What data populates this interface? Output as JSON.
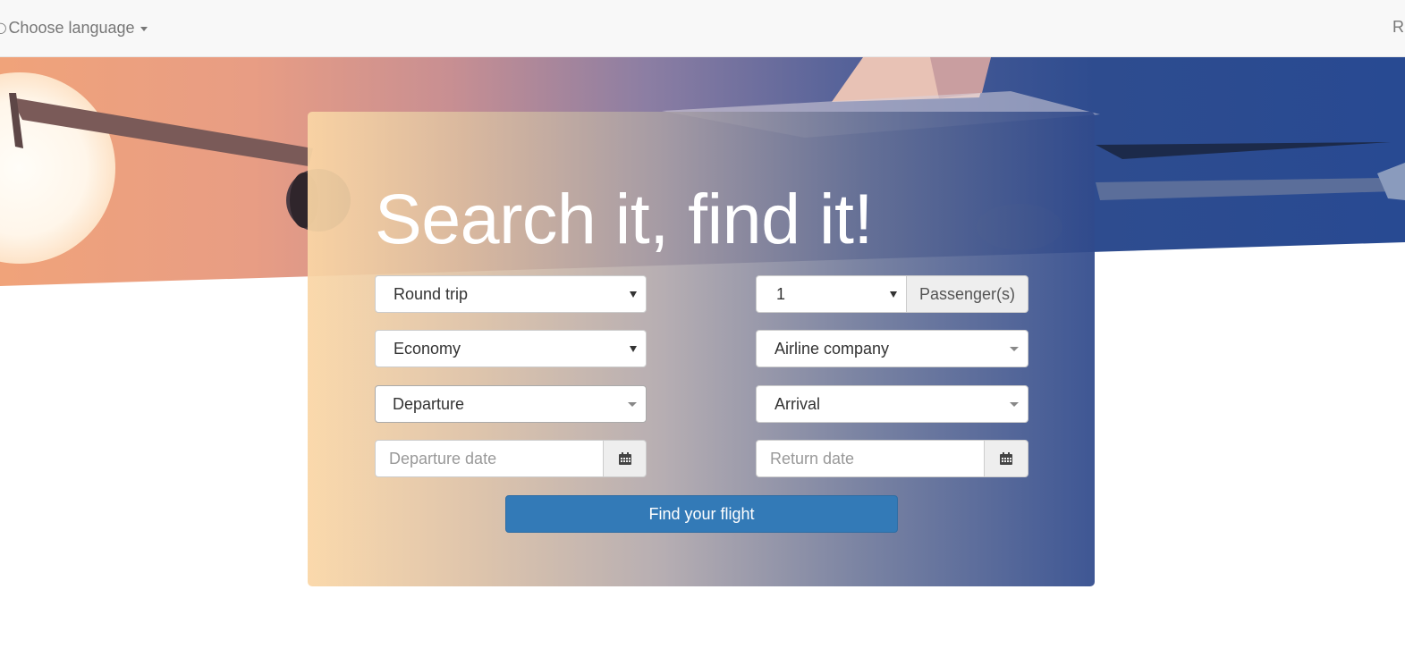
{
  "navbar": {
    "language_label": "Choose language",
    "right_link": "R",
    "globe_icon": "globe-icon"
  },
  "hero": {
    "headline": "Search it, find it!"
  },
  "form": {
    "trip_type": {
      "selected": "Round trip"
    },
    "passengers": {
      "selected": "1",
      "addon": "Passenger(s)"
    },
    "cabin_class": {
      "selected": "Economy"
    },
    "airline": {
      "selected": "Airline company"
    },
    "departure": {
      "selected": "Departure"
    },
    "arrival": {
      "selected": "Arrival"
    },
    "departure_date": {
      "placeholder": "Departure date",
      "icon": "calendar-icon"
    },
    "return_date": {
      "placeholder": "Return date",
      "icon": "calendar-icon"
    },
    "submit_label": "Find your flight"
  },
  "colors": {
    "button_primary": "#337ab7",
    "navbar_bg": "#f8f8f8",
    "panel_gradient_start": "#fad6a5",
    "panel_gradient_end": "#304a8c"
  }
}
